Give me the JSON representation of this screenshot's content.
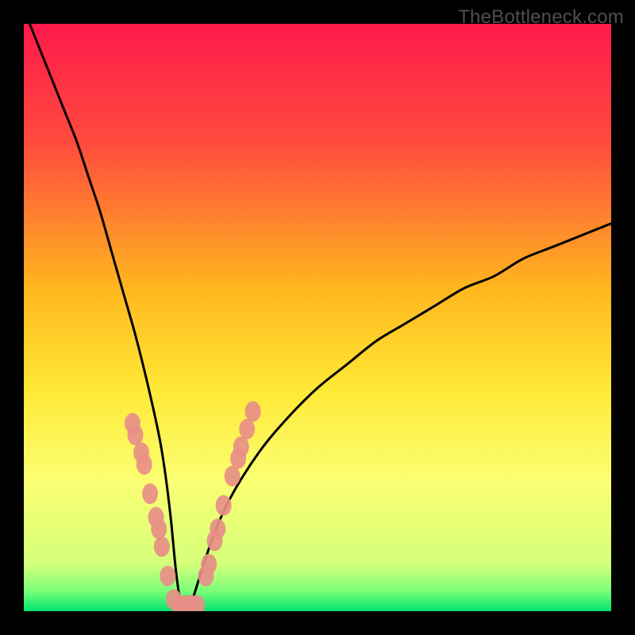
{
  "watermark": "TheBottleneck.com",
  "chart_data": {
    "type": "line",
    "title": "",
    "xlabel": "",
    "ylabel": "",
    "xlim": [
      0,
      100
    ],
    "ylim": [
      0,
      100
    ],
    "grid": false,
    "legend": false,
    "background_gradient": {
      "stops": [
        {
          "offset": 0.0,
          "color": "#ff1a4b"
        },
        {
          "offset": 0.2,
          "color": "#ff4a3e"
        },
        {
          "offset": 0.45,
          "color": "#ffb61f"
        },
        {
          "offset": 0.62,
          "color": "#ffe835"
        },
        {
          "offset": 0.78,
          "color": "#fbff73"
        },
        {
          "offset": 0.92,
          "color": "#d4ff7a"
        },
        {
          "offset": 0.965,
          "color": "#7dff7a"
        },
        {
          "offset": 1.0,
          "color": "#00e36e"
        }
      ]
    },
    "series": [
      {
        "name": "bottleneck-curve",
        "color": "#000000",
        "x": [
          1,
          3,
          5,
          7,
          9,
          11,
          13,
          15,
          17,
          19,
          21,
          23,
          24,
          25,
          26,
          27,
          28,
          30,
          32,
          35,
          40,
          45,
          50,
          55,
          60,
          65,
          70,
          75,
          80,
          85,
          90,
          95,
          100
        ],
        "y": [
          100,
          95,
          90,
          85,
          80,
          74,
          68,
          61,
          54,
          47,
          39,
          30,
          24,
          16,
          6,
          0,
          0,
          6,
          12,
          19,
          27,
          33,
          38,
          42,
          46,
          49,
          52,
          55,
          57,
          60,
          62,
          64,
          66
        ]
      }
    ],
    "markers": {
      "name": "highlighted-points",
      "color": "#e78f87",
      "points": [
        {
          "x": 18.5,
          "y": 32
        },
        {
          "x": 19.0,
          "y": 30
        },
        {
          "x": 20.0,
          "y": 27
        },
        {
          "x": 20.5,
          "y": 25
        },
        {
          "x": 21.5,
          "y": 20
        },
        {
          "x": 22.5,
          "y": 16
        },
        {
          "x": 23.0,
          "y": 14
        },
        {
          "x": 23.5,
          "y": 11
        },
        {
          "x": 24.5,
          "y": 6
        },
        {
          "x": 25.5,
          "y": 2
        },
        {
          "x": 26.5,
          "y": 1
        },
        {
          "x": 27.5,
          "y": 1
        },
        {
          "x": 28.5,
          "y": 1
        },
        {
          "x": 29.5,
          "y": 1
        },
        {
          "x": 31.0,
          "y": 6
        },
        {
          "x": 31.5,
          "y": 8
        },
        {
          "x": 32.5,
          "y": 12
        },
        {
          "x": 33.0,
          "y": 14
        },
        {
          "x": 34.0,
          "y": 18
        },
        {
          "x": 35.5,
          "y": 23
        },
        {
          "x": 36.5,
          "y": 26
        },
        {
          "x": 37.0,
          "y": 28
        },
        {
          "x": 38.0,
          "y": 31
        },
        {
          "x": 39.0,
          "y": 34
        }
      ]
    }
  }
}
